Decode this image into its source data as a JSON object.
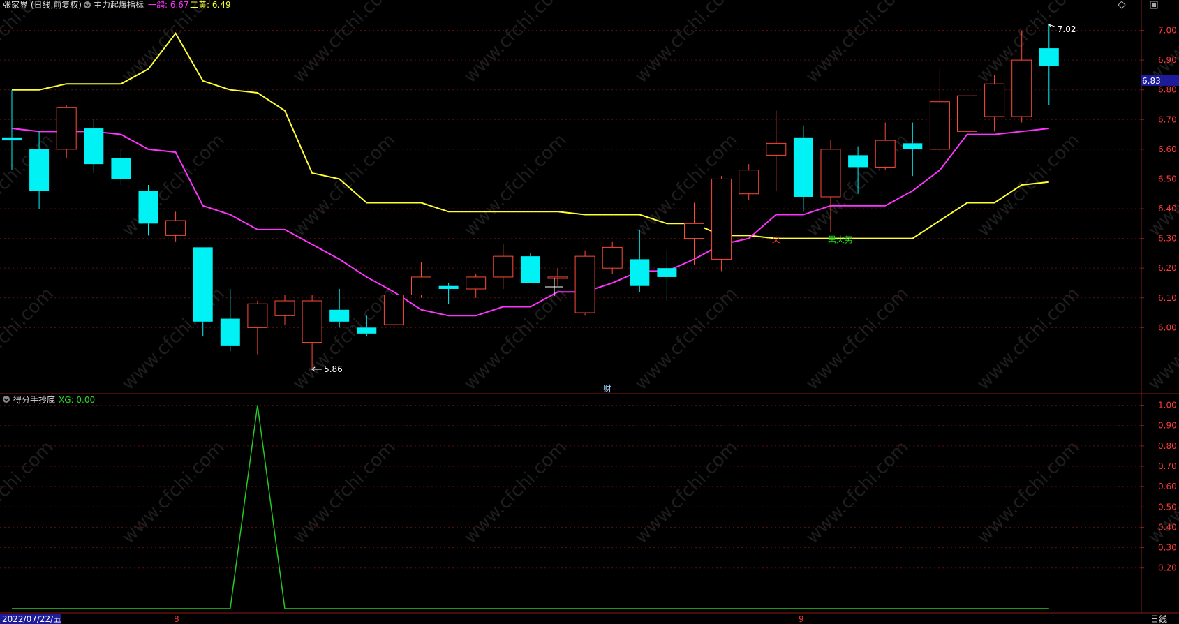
{
  "colors": {
    "background": "#000000",
    "frame": "#8b1a1a",
    "grid": "#5a0f0f",
    "up_candle": "#ff4a3a",
    "down_candle": "#00f2f5",
    "yellow_line": "#ffff33",
    "magenta_line": "#ff33ff",
    "signal_line": "#22cc22",
    "axis_text": "#ff3a3a",
    "price_tag_bg": "#1c1c9a"
  },
  "header": {
    "stock": "张家界 (日线,前复权)",
    "indicator_name": "主力起爆指标",
    "line1_label": "一鸽: 6.67",
    "line2_label": "二黄: 6.49",
    "icons": [
      "diamond-icon",
      "restore-icon"
    ]
  },
  "sub_header": {
    "indicator_name": "得分手抄底",
    "value_label": "XG: 0.00"
  },
  "annotations": {
    "high_label": "7.02",
    "low_label": "5.86",
    "cai_marker": "财",
    "huo_marker": "火",
    "black_trend": "黑火势",
    "current_price": "6.83"
  },
  "bottom_bar": {
    "date": "2022/07/22/五",
    "month1": "8",
    "month2": "9",
    "period": "日线"
  },
  "chart_data": [
    {
      "type": "candlestick",
      "title": "",
      "ylim": [
        5.78,
        7.06
      ],
      "yticks": [
        "7.00",
        "6.90",
        "6.80",
        "6.70",
        "6.60",
        "6.50",
        "6.40",
        "6.30",
        "6.20",
        "6.10",
        "6.00"
      ],
      "candles": [
        {
          "o": 6.64,
          "c": 6.63,
          "h": 6.8,
          "l": 6.53
        },
        {
          "o": 6.6,
          "c": 6.46,
          "h": 6.66,
          "l": 6.4
        },
        {
          "o": 6.6,
          "c": 6.74,
          "h": 6.75,
          "l": 6.57
        },
        {
          "o": 6.67,
          "c": 6.55,
          "h": 6.7,
          "l": 6.52
        },
        {
          "o": 6.57,
          "c": 6.5,
          "h": 6.6,
          "l": 6.48
        },
        {
          "o": 6.46,
          "c": 6.35,
          "h": 6.48,
          "l": 6.31
        },
        {
          "o": 6.31,
          "c": 6.36,
          "h": 6.39,
          "l": 6.29
        },
        {
          "o": 6.27,
          "c": 6.02,
          "h": 6.27,
          "l": 5.97
        },
        {
          "o": 6.03,
          "c": 5.94,
          "h": 6.13,
          "l": 5.92
        },
        {
          "o": 6.0,
          "c": 6.08,
          "h": 6.09,
          "l": 5.91
        },
        {
          "o": 6.04,
          "c": 6.09,
          "h": 6.11,
          "l": 6.01
        },
        {
          "o": 5.95,
          "c": 6.09,
          "h": 6.11,
          "l": 5.86
        },
        {
          "o": 6.06,
          "c": 6.02,
          "h": 6.13,
          "l": 6.0
        },
        {
          "o": 6.0,
          "c": 5.98,
          "h": 6.04,
          "l": 5.97
        },
        {
          "o": 6.01,
          "c": 6.11,
          "h": 6.12,
          "l": 6.0
        },
        {
          "o": 6.11,
          "c": 6.17,
          "h": 6.22,
          "l": 6.1
        },
        {
          "o": 6.14,
          "c": 6.13,
          "h": 6.15,
          "l": 6.08
        },
        {
          "o": 6.13,
          "c": 6.17,
          "h": 6.18,
          "l": 6.1
        },
        {
          "o": 6.17,
          "c": 6.24,
          "h": 6.28,
          "l": 6.13
        },
        {
          "o": 6.24,
          "c": 6.15,
          "h": 6.25,
          "l": 6.15
        },
        {
          "o": 6.17,
          "c": 6.17,
          "h": 6.2,
          "l": 6.14
        },
        {
          "o": 6.05,
          "c": 6.24,
          "h": 6.26,
          "l": 6.04
        },
        {
          "o": 6.2,
          "c": 6.27,
          "h": 6.29,
          "l": 6.18
        },
        {
          "o": 6.23,
          "c": 6.14,
          "h": 6.33,
          "l": 6.12
        },
        {
          "o": 6.2,
          "c": 6.17,
          "h": 6.26,
          "l": 6.09
        },
        {
          "o": 6.3,
          "c": 6.35,
          "h": 6.42,
          "l": 6.21
        },
        {
          "o": 6.23,
          "c": 6.5,
          "h": 6.51,
          "l": 6.19
        },
        {
          "o": 6.45,
          "c": 6.53,
          "h": 6.55,
          "l": 6.43
        },
        {
          "o": 6.58,
          "c": 6.62,
          "h": 6.73,
          "l": 6.46
        },
        {
          "o": 6.64,
          "c": 6.44,
          "h": 6.68,
          "l": 6.39
        },
        {
          "o": 6.44,
          "c": 6.6,
          "h": 6.63,
          "l": 6.32
        },
        {
          "o": 6.58,
          "c": 6.54,
          "h": 6.61,
          "l": 6.45
        },
        {
          "o": 6.54,
          "c": 6.63,
          "h": 6.69,
          "l": 6.53
        },
        {
          "o": 6.62,
          "c": 6.6,
          "h": 6.69,
          "l": 6.51
        },
        {
          "o": 6.6,
          "c": 6.76,
          "h": 6.87,
          "l": 6.59
        },
        {
          "o": 6.66,
          "c": 6.78,
          "h": 6.98,
          "l": 6.54
        },
        {
          "o": 6.71,
          "c": 6.82,
          "h": 6.85,
          "l": 6.66
        },
        {
          "o": 6.71,
          "c": 6.9,
          "h": 7.0,
          "l": 6.69
        },
        {
          "o": 6.94,
          "c": 6.88,
          "h": 7.02,
          "l": 6.75
        }
      ],
      "series": [
        {
          "name": "二黄",
          "values": [
            6.8,
            6.8,
            6.82,
            6.82,
            6.82,
            6.87,
            6.99,
            6.83,
            6.8,
            6.79,
            6.73,
            6.52,
            6.5,
            6.42,
            6.42,
            6.42,
            6.39,
            6.39,
            6.39,
            6.39,
            6.39,
            6.38,
            6.38,
            6.38,
            6.35,
            6.35,
            6.31,
            6.31,
            6.3,
            6.3,
            6.3,
            6.3,
            6.3,
            6.3,
            6.36,
            6.42,
            6.42,
            6.48,
            6.49
          ]
        },
        {
          "name": "一鸽",
          "values": [
            6.67,
            6.66,
            6.66,
            6.66,
            6.65,
            6.6,
            6.59,
            6.41,
            6.38,
            6.33,
            6.33,
            6.28,
            6.23,
            6.17,
            6.12,
            6.06,
            6.04,
            6.04,
            6.07,
            6.07,
            6.12,
            6.12,
            6.15,
            6.19,
            6.19,
            6.23,
            6.28,
            6.3,
            6.38,
            6.38,
            6.41,
            6.41,
            6.41,
            6.46,
            6.53,
            6.65,
            6.65,
            6.66,
            6.67
          ]
        }
      ]
    },
    {
      "type": "line",
      "title": "",
      "ylim": [
        0,
        1.05
      ],
      "yticks": [
        "1.00",
        "0.90",
        "0.80",
        "0.70",
        "0.60",
        "0.50",
        "0.40",
        "0.30",
        "0.20"
      ],
      "series": [
        {
          "name": "XG",
          "values": [
            0,
            0,
            0,
            0,
            0,
            0,
            0,
            0,
            0,
            1,
            0,
            0,
            0,
            0,
            0,
            0,
            0,
            0,
            0,
            0,
            0,
            0,
            0,
            0,
            0,
            0,
            0,
            0,
            0,
            0,
            0,
            0,
            0,
            0,
            0,
            0,
            0,
            0,
            0
          ]
        }
      ]
    }
  ]
}
